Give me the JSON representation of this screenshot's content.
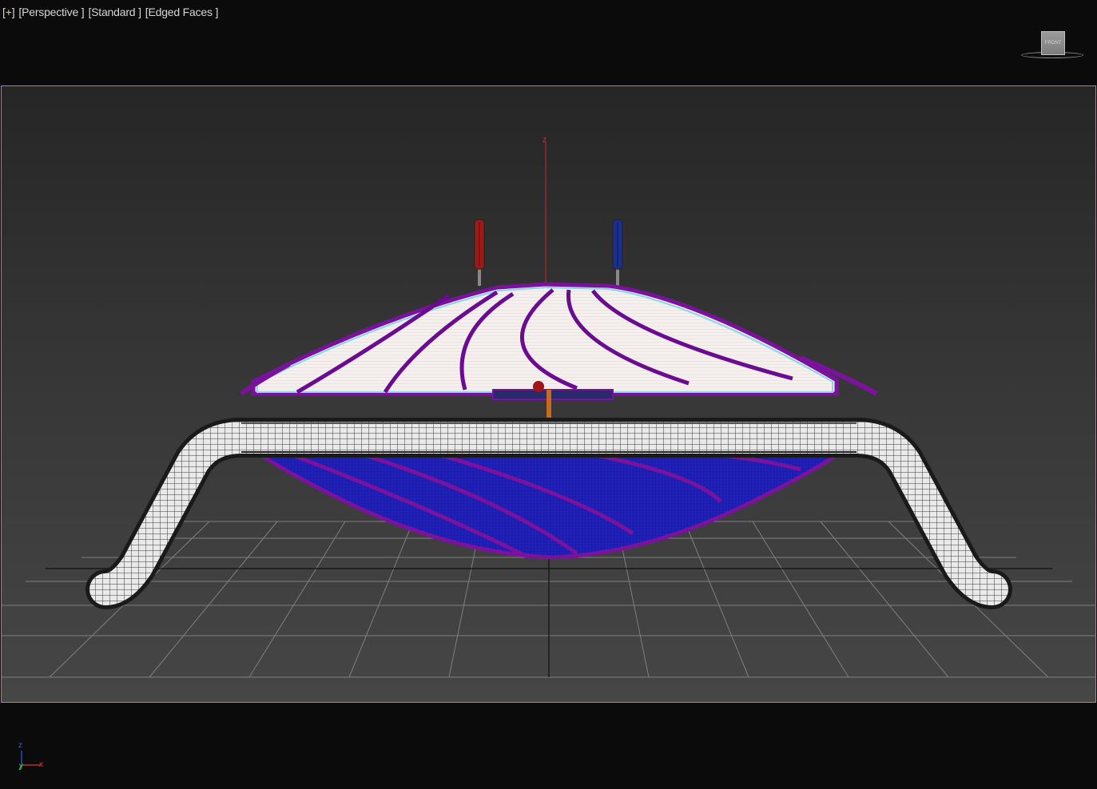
{
  "viewport": {
    "labels": [
      {
        "text": "+",
        "name": "viewport-general-menu"
      },
      {
        "text": "Perspective ",
        "name": "viewport-point-of-view-menu"
      },
      {
        "text": "Standard ",
        "name": "viewport-shading-quality-menu"
      },
      {
        "text": "Edged Faces ",
        "name": "viewport-display-style-menu"
      }
    ],
    "viewcube_face": "FRONT",
    "gizmo_labels": {
      "z": "z",
      "x": "x"
    },
    "tripod": {
      "z": "z",
      "x": "x",
      "y": "y"
    }
  },
  "colors": {
    "frame_border": "#a39a2c",
    "accent_plus": "#e8d24a",
    "selection_purple": "#7a129e",
    "shade_blue": "#1a1aa8",
    "gizmo_red": "#b02a2a"
  },
  "icons": {
    "viewcube": "viewcube-icon",
    "axis_tripod": "axis-tripod-icon",
    "transform_gizmo": "transform-gizmo-icon"
  }
}
